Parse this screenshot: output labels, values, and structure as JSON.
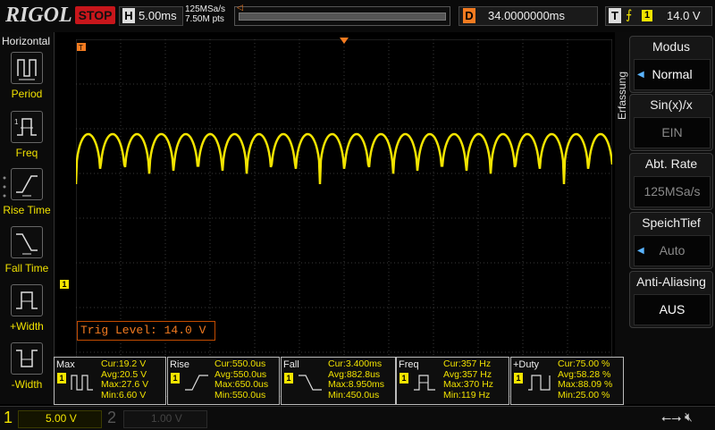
{
  "brand": "RIGOL",
  "top": {
    "run_state": "STOP",
    "timebase_letter": "H",
    "timebase": "5.00ms",
    "sample_rate": "125MSa/s",
    "memory_points": "7.50M pts",
    "delay_letter": "D",
    "delay": "34.0000000ms",
    "trigger_letter": "T",
    "trigger_source": "1",
    "trigger_level": "14.0 V"
  },
  "left_menu": {
    "title": "Horizontal",
    "items": [
      {
        "label": "Period",
        "icon": "period-icon"
      },
      {
        "label": "Freq",
        "icon": "frequency-icon"
      },
      {
        "label": "Rise Time",
        "icon": "rise-time-icon"
      },
      {
        "label": "Fall Time",
        "icon": "fall-time-icon"
      },
      {
        "label": "+Width",
        "icon": "positive-width-icon"
      },
      {
        "label": "-Width",
        "icon": "negative-width-icon"
      }
    ]
  },
  "right_menu": {
    "side_label": "Erfassung",
    "buttons": [
      {
        "title": "Modus",
        "value": "Normal",
        "active": true
      },
      {
        "title": "Sin(x)/x",
        "value": "EIN",
        "active": false
      },
      {
        "title": "Abt. Rate",
        "value": "125MSa/s",
        "active": false
      },
      {
        "title": "SpeichTief",
        "value": "Auto",
        "active": false
      },
      {
        "title": "Anti-Aliasing",
        "value": "AUS",
        "active": true
      }
    ]
  },
  "markers": {
    "trigger_position": "T",
    "channel1": "1"
  },
  "trig_level_box": "Trig Level: 14.0 V",
  "measurements": [
    {
      "name": "Max",
      "ch": "1",
      "icon": "max-measure-icon",
      "lines": [
        "Cur:19.2 V",
        "Avg:20.5 V",
        "Max:27.6 V",
        "Min:6.60 V"
      ]
    },
    {
      "name": "Rise",
      "ch": "1",
      "icon": "rise-measure-icon",
      "lines": [
        "Cur:550.0us",
        "Avg:550.0us",
        "Max:650.0us",
        "Min:550.0us"
      ]
    },
    {
      "name": "Fall",
      "ch": "1",
      "icon": "fall-measure-icon",
      "lines": [
        "Cur:3.400ms",
        "Avg:882.8us",
        "Max:8.950ms",
        "Min:450.0us"
      ]
    },
    {
      "name": "Freq",
      "ch": "1",
      "icon": "freq-measure-icon",
      "lines": [
        "Cur:357 Hz",
        "Avg:357 Hz",
        "Max:370 Hz",
        "Min:119 Hz"
      ]
    },
    {
      "name": "+Duty",
      "ch": "1",
      "icon": "duty-measure-icon",
      "lines": [
        "Cur:75.00 %",
        "Avg:58.28 %",
        "Max:88.09 %",
        "Min:25.00 %"
      ]
    }
  ],
  "bottom": {
    "ch1_num": "1",
    "ch1_scale": "5.00 V",
    "ch2_num": "2",
    "ch2_scale": "1.00 V"
  },
  "colors": {
    "ch1": "#f2e400",
    "trigger": "#f47b20",
    "stop": "#c8161b",
    "grid": "#3a3a3a"
  }
}
